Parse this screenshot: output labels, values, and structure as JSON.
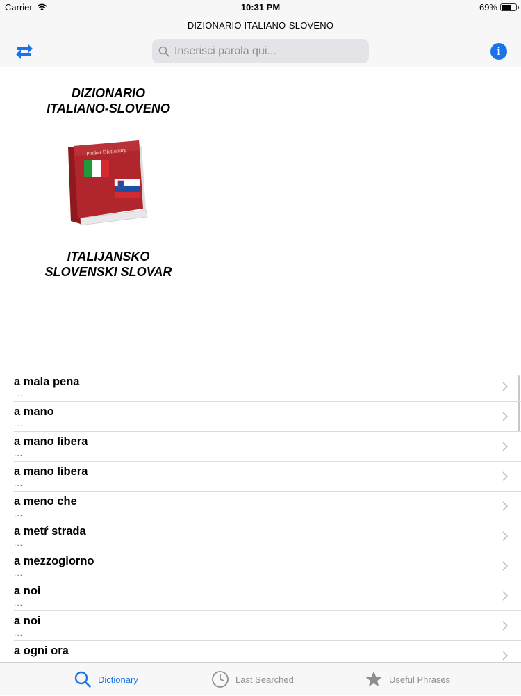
{
  "status_bar": {
    "carrier": "Carrier",
    "time": "10:31 PM",
    "battery": "69%",
    "battery_level": 0.69,
    "wifi_icon": "wifi-icon"
  },
  "nav": {
    "title": "DIZIONARIO ITALIANO-SLOVENO",
    "search_placeholder": "Inserisci parola qui...",
    "search_value": "",
    "swap_icon": "swap-language-icon",
    "info_icon": "info-icon",
    "info_glyph": "i",
    "accent_color": "#1a73e8"
  },
  "header": {
    "title_line1": "DIZIONARIO",
    "title_line2": "ITALIANO-SLOVENO",
    "subtitle_line1": "ITALIJANSKO",
    "subtitle_line2": "SLOVENSKI SLOVAR",
    "book_label": "Pocket Dictionary"
  },
  "entries": [
    {
      "word": "a mala pena",
      "meaning": "..."
    },
    {
      "word": "a mano",
      "meaning": "..."
    },
    {
      "word": "a mano libera",
      "meaning": "..."
    },
    {
      "word": "a mano libera",
      "meaning": "..."
    },
    {
      "word": "a meno che",
      "meaning": "..."
    },
    {
      "word": "a metŕ strada",
      "meaning": "..."
    },
    {
      "word": "a mezzogiorno",
      "meaning": "..."
    },
    {
      "word": "a noi",
      "meaning": "..."
    },
    {
      "word": "a noi",
      "meaning": "..."
    },
    {
      "word": "a ogni ora",
      "meaning": "..."
    }
  ],
  "tabs": [
    {
      "label": "Dictionary",
      "icon": "search-icon",
      "active": true
    },
    {
      "label": "Last Searched",
      "icon": "clock-icon",
      "active": false
    },
    {
      "label": "Useful Phrases",
      "icon": "star-icon",
      "active": false
    }
  ]
}
